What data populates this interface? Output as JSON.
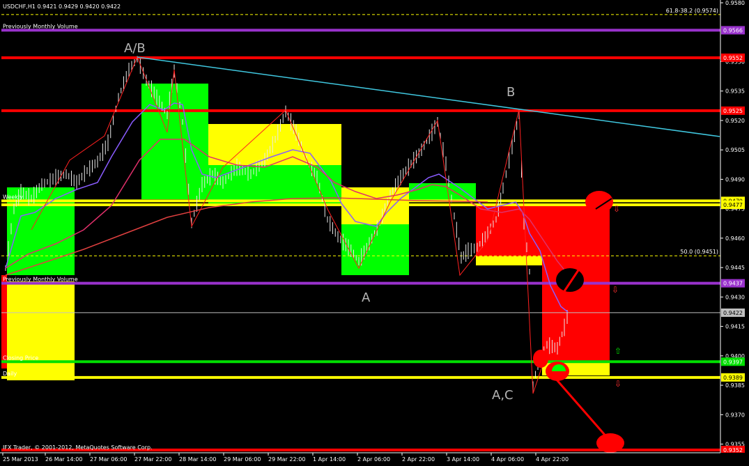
{
  "window": {
    "symbol_title": "USDCHF,H1  0.9421  0.9429  0.9420  0.9422",
    "copyright": "IFX Trader, © 2001-2012, MetaQuotes Software Corp."
  },
  "chart_data": {
    "type": "candlestick",
    "symbol": "USDCHF",
    "timeframe": "H1",
    "ohlc_last": {
      "open": 0.9421,
      "high": 0.9429,
      "low": 0.942,
      "close": 0.9422
    },
    "y_range": [
      0.9352,
      0.958
    ],
    "price_axis_ticks": [
      "0.9580",
      "0.9550",
      "0.9535",
      "0.9520",
      "0.9505",
      "0.9490",
      "0.9475",
      "0.9460",
      "0.9445",
      "0.9430",
      "0.9415",
      "0.9400",
      "0.9385",
      "0.9370",
      "0.9355"
    ],
    "time_axis_labels": [
      "25 Mar 2013",
      "26 Mar 14:00",
      "27 Mar 06:00",
      "27 Mar 22:00",
      "28 Mar 14:00",
      "29 Mar 06:00",
      "29 Mar 22:00",
      "1 Apr 14:00",
      "2 Apr 06:00",
      "2 Apr 22:00",
      "3 Apr 14:00",
      "4 Apr 06:00",
      "4 Apr 22:00"
    ],
    "horizontal_levels": [
      {
        "price": 0.9574,
        "label": "61.8-38.2 (0.9574)",
        "color": "#ffff00",
        "style": "dashed"
      },
      {
        "price": 0.9566,
        "name": "Previously Monthly Volume",
        "tag": "0.9566",
        "color": "#9932cc"
      },
      {
        "price": 0.9552,
        "tag": "0.9552",
        "color": "#ff0000"
      },
      {
        "price": 0.9525,
        "tag": "0.9525",
        "color": "#ff0000"
      },
      {
        "price": 0.9479,
        "tag": "0.9479",
        "name": "Weekly",
        "color": "#ffff00"
      },
      {
        "price": 0.9477,
        "tag": "0.9477",
        "color": "#ffff00"
      },
      {
        "price": 0.9451,
        "label": "50.0 (0.9451)",
        "color": "#ffff00",
        "style": "dashed"
      },
      {
        "price": 0.9437,
        "name": "Previously Monthly Volume",
        "tag": "0.9437",
        "color": "#9932cc"
      },
      {
        "price": 0.9422,
        "tag": "0.9422",
        "color": "#c0c0c0",
        "style": "thin"
      },
      {
        "price": 0.9397,
        "name": "Closing Price",
        "tag": "0.9397",
        "color": "#00e000"
      },
      {
        "price": 0.9389,
        "name": "Daily",
        "tag": "0.9389",
        "color": "#ffff00"
      },
      {
        "price": 0.9352,
        "tag": "0.9352",
        "color": "#ff0000"
      }
    ],
    "wave_labels": [
      "A/B",
      "B",
      "A",
      "A,C"
    ],
    "colors": {
      "bull_zone": "#00ff00",
      "neutral_zone": "#ffff00",
      "bear_zone": "#ff0000",
      "trendline": "#40c8e0",
      "ma_fast": "#8a5cff",
      "ma_slow": "#e0306a",
      "zigzag": "#ff2020"
    },
    "grid": false
  }
}
